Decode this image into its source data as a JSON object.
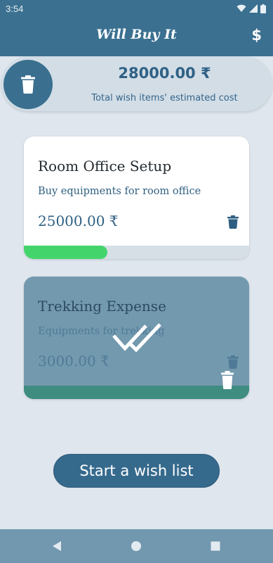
{
  "status_bar": {
    "time": "3:54"
  },
  "app_bar": {
    "title": "Will Buy It",
    "currency_symbol": "$"
  },
  "summary": {
    "total": "28000.00 ₹",
    "label": "Total wish items' estimated cost"
  },
  "wishes": [
    {
      "title": "Room Office Setup",
      "description": "Buy equipments for room office",
      "amount": "25000.00 ₹",
      "progress": 0.37,
      "state": "active"
    },
    {
      "title": "Trekking Expense",
      "description": "Equipments for trekking",
      "amount": "3000.00 ₹",
      "progress": 1.0,
      "state": "completed"
    }
  ],
  "actions": {
    "start_label": "Start a wish list"
  },
  "icons": {
    "summary": "delete-icon",
    "card_action": "delete-icon",
    "completed": "double-check-icon",
    "swipe": "delete-icon",
    "appbar_action": "dollar-icon",
    "nav": [
      "back-icon",
      "home-icon",
      "recents-icon"
    ]
  },
  "colors": {
    "primary": "#3b7090",
    "progress": "#44d46c",
    "completed": "#3f8c80",
    "background": "#dfe6ee"
  }
}
